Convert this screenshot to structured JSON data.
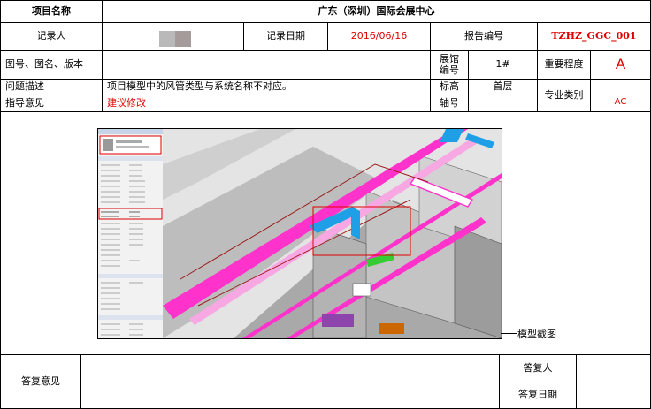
{
  "form": {
    "project_name_label": "项目名称",
    "project_name": "广东（深圳）国际会展中心",
    "recorder_label": "记录人",
    "record_date_label": "记录日期",
    "record_date": "2016/06/16",
    "report_no_label": "报告编号",
    "report_no": "TZHZ_GGC_001",
    "drawing_label": "图号、图名、版本",
    "hall_no_label_1": "展馆",
    "hall_no_label_2": "编号",
    "hall_no": "1#",
    "importance_label": "重要程度",
    "importance": "A",
    "issue_label": "问题描述",
    "issue": "项目模型中的风管类型与系统名称不对应。",
    "elevation_label": "标高",
    "elevation": "首层",
    "discipline_label": "专业类别",
    "discipline": "AC",
    "guidance_label": "指导意见",
    "guidance": "建议修改",
    "axis_label": "轴号",
    "reply_label": "答复意见",
    "replier_label": "答复人",
    "reply_date_label": "答复日期"
  },
  "screenshot": {
    "callout": "模型截图"
  },
  "colors": {
    "accent_red": "#e00000",
    "duct_pink": "#ff33cc",
    "duct_blue": "#1fa0e6",
    "duct_green": "#33cc33"
  }
}
